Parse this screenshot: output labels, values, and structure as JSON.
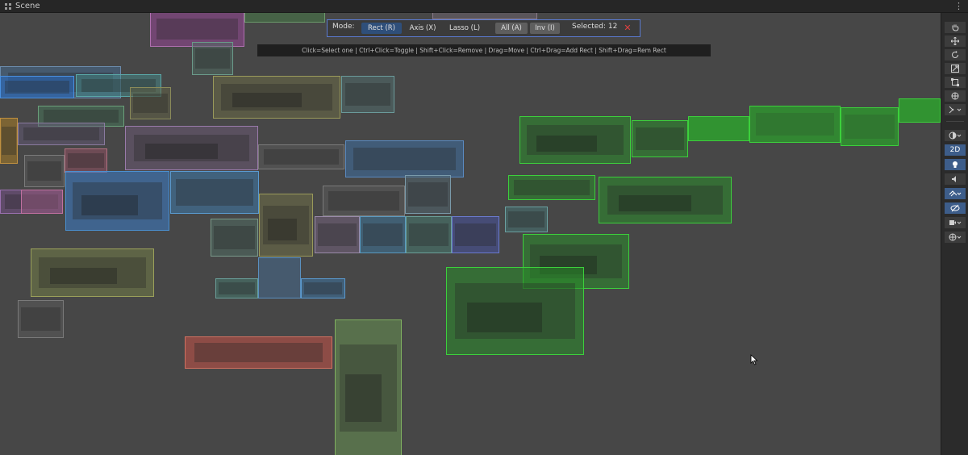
{
  "window": {
    "title": "Scene",
    "more_icon": "kebab-menu-icon"
  },
  "mode_bar": {
    "mode_label": "Mode:",
    "modes": [
      "Rect (R)",
      "Axis (X)",
      "Lasso (L)"
    ],
    "active_mode": "Rect (R)",
    "all_label": "All (A)",
    "inv_label": "Inv (I)",
    "selected_text": "Selected: 12",
    "close_label": "✕"
  },
  "hint_text": "Click=Select one | Ctrl+Click=Toggle | Shift+Click=Remove | Drag=Move | Ctrl+Drag=Add Rect | Shift+Drag=Rem Rect",
  "toolbar": {
    "tools": [
      "hand-tool-icon",
      "move-tool-icon",
      "rotate-tool-icon",
      "scale-tool-icon",
      "rect-tool-icon",
      "transform-tool-icon",
      "custom-tool-icon"
    ],
    "view_options": {
      "shading_icon": "shading-mode-icon",
      "two_d_label": "2D",
      "lighting_icon": "lighting-icon",
      "audio_icon": "audio-icon",
      "effects_icon": "effects-icon",
      "visibility_icon": "hidden-objects-icon",
      "camera_icon": "scene-camera-icon",
      "gizmos_icon": "gizmos-icon"
    },
    "active_color": "#3d5d8a"
  },
  "rooms": {
    "selected_color": "#3cd03c",
    "count_selected": 12
  }
}
